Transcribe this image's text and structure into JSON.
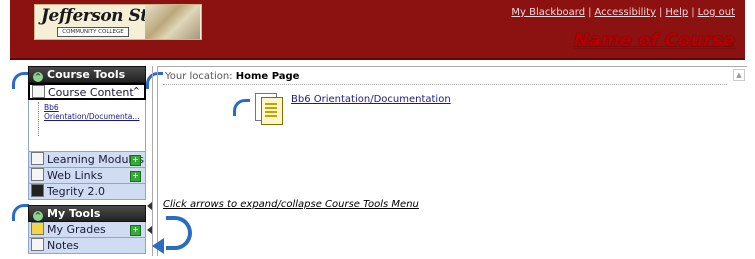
{
  "header": {
    "logo_text": "Jefferson State",
    "logo_subtext": "COMMUNITY COLLEGE",
    "links": [
      "My Blackboard",
      "Accessibility",
      "Help",
      "Log out"
    ],
    "course_name": "Name of Course"
  },
  "left_menu": {
    "course_tools_title": "Course Tools",
    "course_content_label": "Course Content",
    "tree_items": [
      "Bb6",
      "Orientation/Documenta..."
    ],
    "course_items": [
      {
        "label": "Learning Modules",
        "icon": "module-icon"
      },
      {
        "label": "Web Links",
        "icon": "globe-icon"
      },
      {
        "label": "Tegrity 2.0",
        "icon": "tegrity-icon"
      }
    ],
    "my_tools_title": "My Tools",
    "my_items": [
      {
        "label": "My Grades",
        "icon": "grades-icon"
      },
      {
        "label": "Notes",
        "icon": "notes-icon"
      }
    ]
  },
  "content": {
    "location_prefix": "Your location:",
    "location_value": "Home Page",
    "doc_link": "Bb6 Orientation/Documentation",
    "hint": "Click arrows to expand/collapse Course Tools Menu"
  },
  "colors": {
    "header_bg": "#8c1111",
    "menu_item_bg": "#cfdcf2",
    "arrow_blue": "#2a6cc4",
    "course_name": "#b30000"
  }
}
